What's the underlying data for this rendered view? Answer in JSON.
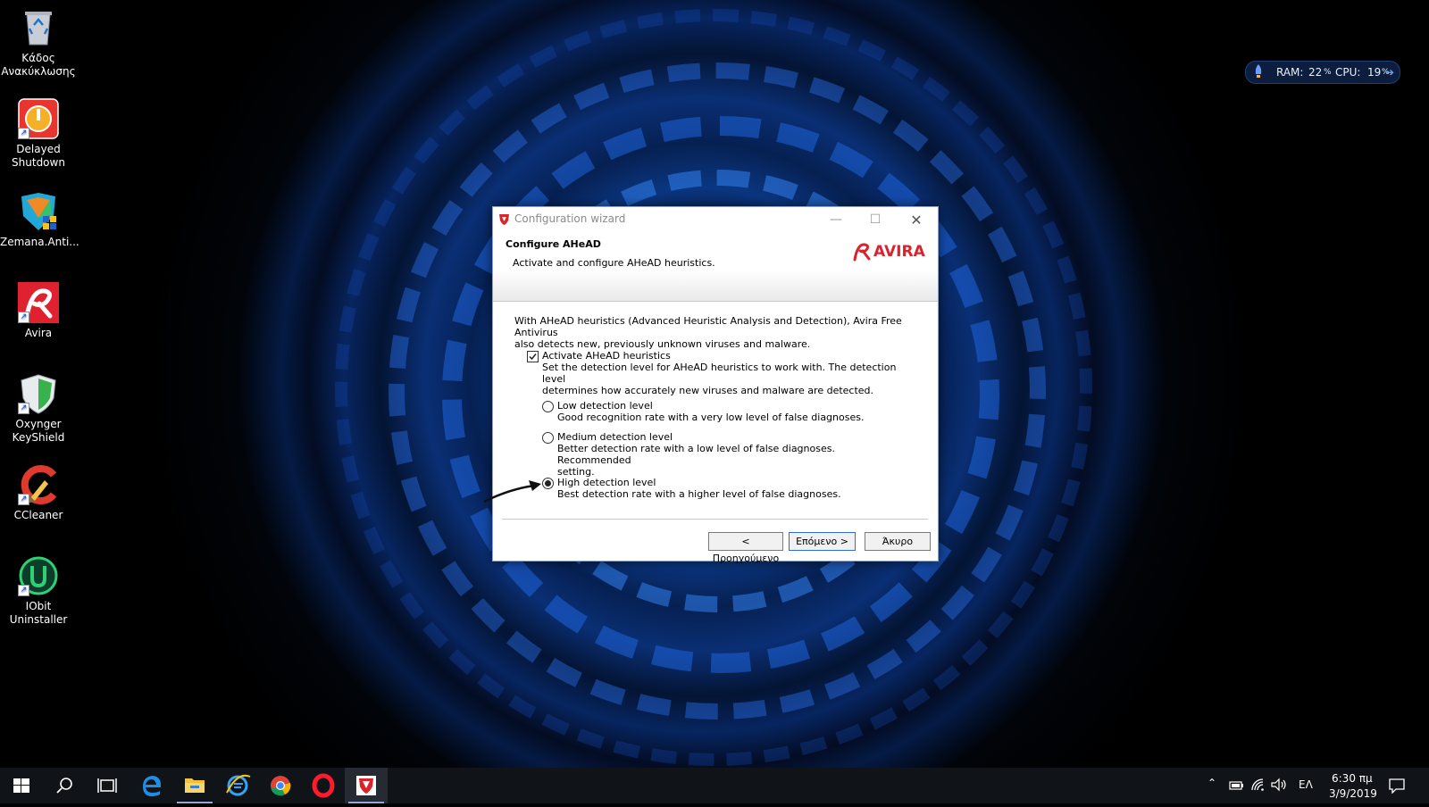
{
  "desktop": {
    "icons": [
      {
        "label_line1": "Κάδος",
        "label_line2": "Ανακύκλωσης",
        "icon": "recycle-bin-icon"
      },
      {
        "label_line1": "Delayed",
        "label_line2": "Shutdown",
        "icon": "power-icon"
      },
      {
        "label_line1": "Zemana.Anti...",
        "label_line2": "",
        "icon": "zemana-shield-icon"
      },
      {
        "label_line1": "Avira",
        "label_line2": "",
        "icon": "avira-icon"
      },
      {
        "label_line1": "Oxynger",
        "label_line2": "KeyShield",
        "icon": "keyshield-icon"
      },
      {
        "label_line1": "CCleaner",
        "label_line2": "",
        "icon": "ccleaner-icon"
      },
      {
        "label_line1": "IObit",
        "label_line2": "Uninstaller",
        "icon": "iobit-icon"
      }
    ]
  },
  "widget": {
    "ram_label": "RAM:",
    "ram_value": "22",
    "cpu_label": "CPU:",
    "cpu_value": "19",
    "percent": "%"
  },
  "dialog": {
    "window_title": "Configuration wizard",
    "header_title": "Configure AHeAD",
    "header_subtitle": "Activate and configure AHeAD heuristics.",
    "brand": "AVIRA",
    "intro_line1": "With AHeAD heuristics (Advanced Heuristic Analysis and Detection), Avira Free Antivirus",
    "intro_line2": "also detects new, previously unknown viruses and malware.",
    "activate_label": "Activate AHeAD heuristics",
    "activate_checked": true,
    "activate_desc_line1": "Set the detection level for AHeAD heuristics to work with. The detection level",
    "activate_desc_line2": "determines how accurately new viruses and malware are detected.",
    "options": [
      {
        "label": "Low detection level",
        "desc_line1": "Good recognition rate with a very low level of false diagnoses.",
        "desc_line2": "",
        "selected": false
      },
      {
        "label": "Medium detection level",
        "desc_line1": "Better detection rate with a low level of false diagnoses. Recommended",
        "desc_line2": "setting.",
        "selected": false
      },
      {
        "label": "High detection level",
        "desc_line1": "Best detection rate with a higher level of false diagnoses.",
        "desc_line2": "",
        "selected": true
      }
    ],
    "buttons": {
      "back": "< Προηγούμενο",
      "next": "Επόμενο >",
      "cancel": "Άκυρο"
    }
  },
  "taskbar": {
    "apps": [
      "start-icon",
      "search-icon",
      "task-view-icon",
      "edge-icon",
      "file-explorer-icon",
      "ie-icon",
      "chrome-icon",
      "opera-icon",
      "avira-taskbar-icon"
    ],
    "language": "ΕΛ",
    "time": "6:30 πμ",
    "date": "3/9/2019"
  },
  "colors": {
    "avira_red": "#d9232d",
    "accent_blue": "#2c6dd6"
  }
}
